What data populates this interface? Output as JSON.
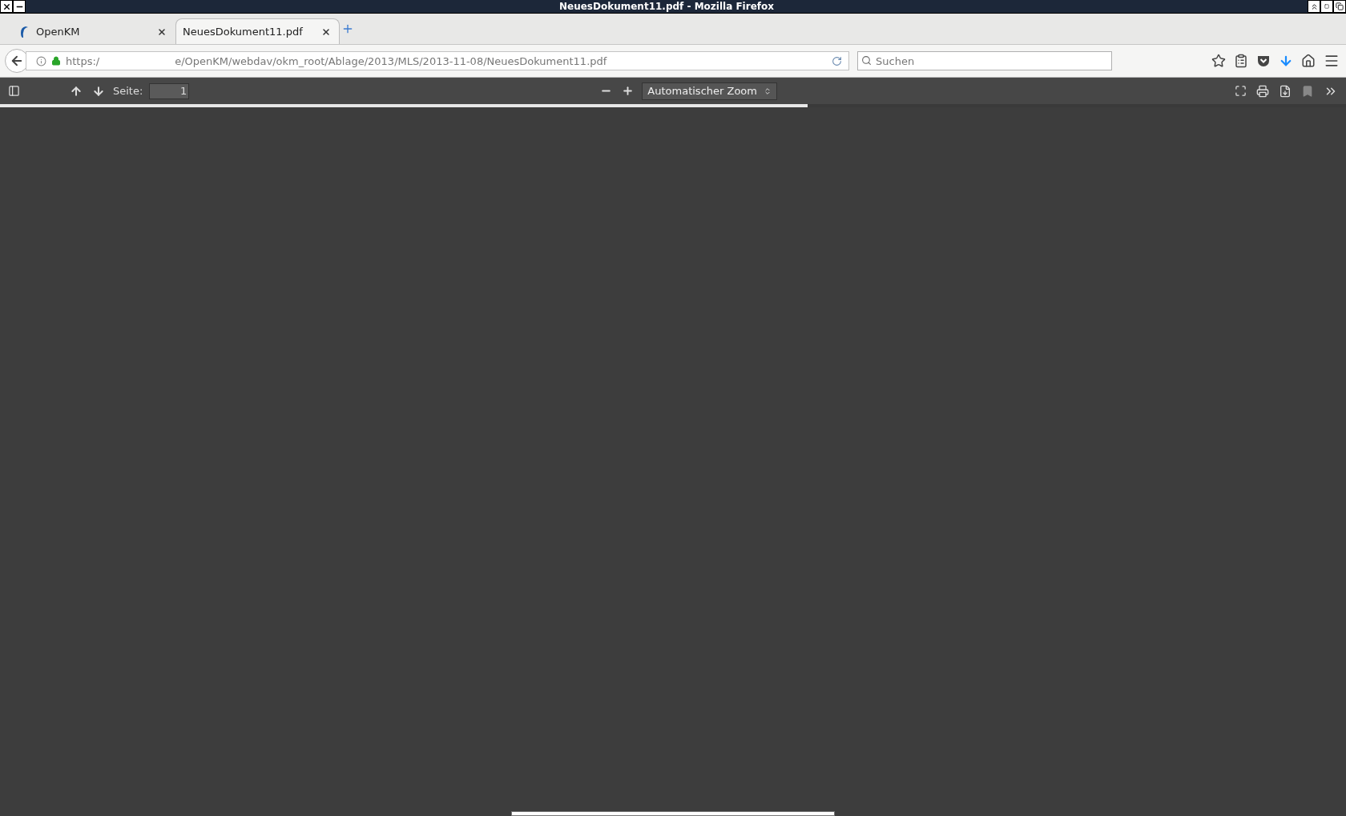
{
  "window": {
    "title": "NeuesDokument11.pdf - Mozilla Firefox"
  },
  "tabs": [
    {
      "label": "OpenKM",
      "selected": false
    },
    {
      "label": "NeuesDokument11.pdf",
      "selected": true
    }
  ],
  "address_bar": {
    "url_start": "https:/",
    "url_end": "e/OpenKM/webdav/okm_root/Ablage/2013/MLS/2013-11-08/NeuesDokument11.pdf"
  },
  "search": {
    "placeholder": "Suchen"
  },
  "pdf_toolbar": {
    "page_label": "Seite:",
    "page_value": "1",
    "zoom": "Automatischer Zoom"
  },
  "loading": {
    "level": 0.6
  }
}
